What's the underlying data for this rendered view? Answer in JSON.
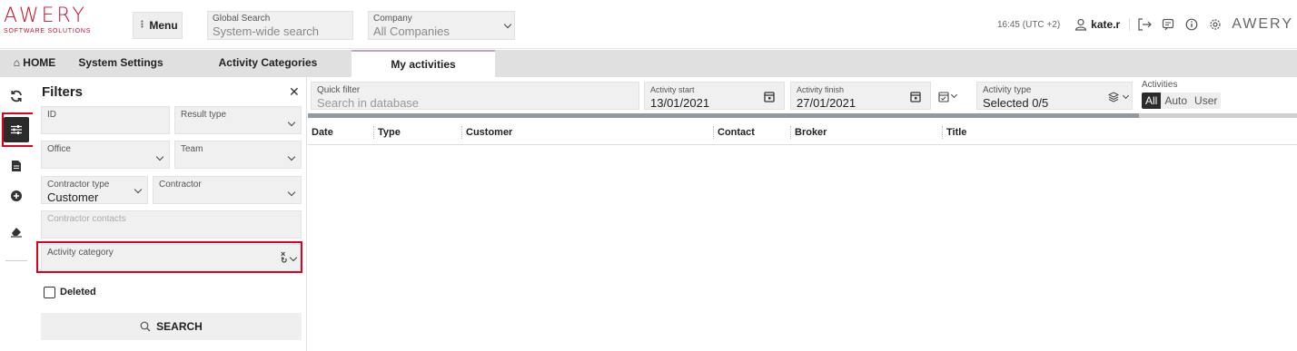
{
  "app": {
    "logo_main": "AWERY",
    "logo_sub": "SOFTWARE SOLUTIONS",
    "menu_label": "Menu",
    "global_search": {
      "label": "Global Search",
      "placeholder": "System-wide search"
    },
    "company": {
      "label": "Company",
      "value": "All Companies"
    },
    "time": "16:45 (UTC +2)",
    "user": "kate.r",
    "logo_small": "AWERY"
  },
  "tabs": [
    {
      "label": "HOME",
      "icon": "home-icon"
    },
    {
      "label": "System Settings"
    },
    {
      "label": "Activity Categories"
    },
    {
      "label": "My activities",
      "active": true
    }
  ],
  "filters": {
    "title": "Filters",
    "id_label": "ID",
    "result_type_label": "Result type",
    "office_label": "Office",
    "team_label": "Team",
    "contractor_type": {
      "label": "Contractor type",
      "value": "Customer"
    },
    "contractor_label": "Contractor",
    "contractor_contacts_label": "Contractor contacts",
    "activity_category_label": "Activity category",
    "deleted_label": "Deleted",
    "search_label": "SEARCH"
  },
  "toolbar": {
    "quick_filter": {
      "label": "Quick filter",
      "placeholder": "Search in database"
    },
    "activity_start": {
      "label": "Activity start",
      "value": "13/01/2021"
    },
    "activity_finish": {
      "label": "Activity finish",
      "value": "27/01/2021"
    },
    "activity_type": {
      "label": "Activity type",
      "value": "Selected 0/5"
    },
    "activities": {
      "label": "Activities",
      "options": [
        "All",
        "Auto",
        "User"
      ],
      "selected": "All"
    }
  },
  "progress": 0.84,
  "table": {
    "columns": [
      "Date",
      "Type",
      "Customer",
      "Contact",
      "Broker",
      "Title"
    ]
  },
  "colors": {
    "brand": "#c8102e",
    "highlight": "#e0001b",
    "tab_accent": "#b9a5d4"
  }
}
